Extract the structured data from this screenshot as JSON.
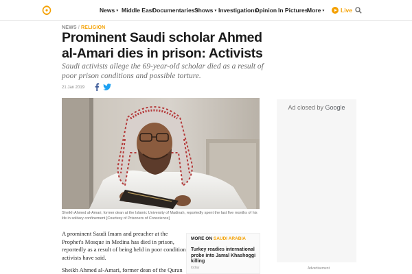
{
  "nav": {
    "logo_icon": "al-jazeera-logo-icon",
    "items": [
      {
        "label": "News",
        "has_dropdown": true
      },
      {
        "label": "Middle East",
        "has_dropdown": false
      },
      {
        "label": "Documentaries",
        "has_dropdown": true
      },
      {
        "label": "Shows",
        "has_dropdown": true
      },
      {
        "label": "Investigations",
        "has_dropdown": false
      },
      {
        "label": "Opinion",
        "has_dropdown": false
      },
      {
        "label": "In Pictures",
        "has_dropdown": false
      },
      {
        "label": "More",
        "has_dropdown": true
      }
    ],
    "live_label": "Live",
    "search_icon": "search-icon",
    "accent_color": "#f4a000"
  },
  "article": {
    "breadcrumb": {
      "section": "NEWS",
      "separator": "/",
      "category": "RELIGION"
    },
    "title": "Prominent Saudi scholar Ahmed al-Amari dies in prison: Activists",
    "subtitle": "Saudi activists allege the 69-year-old scholar died as a result of poor prison conditions and possible torture.",
    "date": "21 Jan 2019",
    "share_icons": [
      "facebook-icon",
      "twitter-icon"
    ],
    "caption": "Sheikh Ahmed al-Amari, former dean at the Islamic University of Madinah, reportedly spent the last five months of his life in solitary confinement [Courtesy of Prisoners of Conscience]",
    "paragraphs": [
      "A prominent Saudi Imam and preacher at the Prophet's Mosque in Medina has died in prison, reportedly as a result of being held in poor conditions, activists have said.",
      "Sheikh Ahmed al-Amari, former dean of the Quran"
    ],
    "more_on": {
      "label": "MORE ON",
      "category": "SAUDI ARABIA",
      "headline": "Turkey readies international probe into Jamal Khashoggi killing",
      "time": "today"
    }
  },
  "ad": {
    "closed_text": "Ad closed by",
    "brand": "Google",
    "label": "Advertisement"
  }
}
